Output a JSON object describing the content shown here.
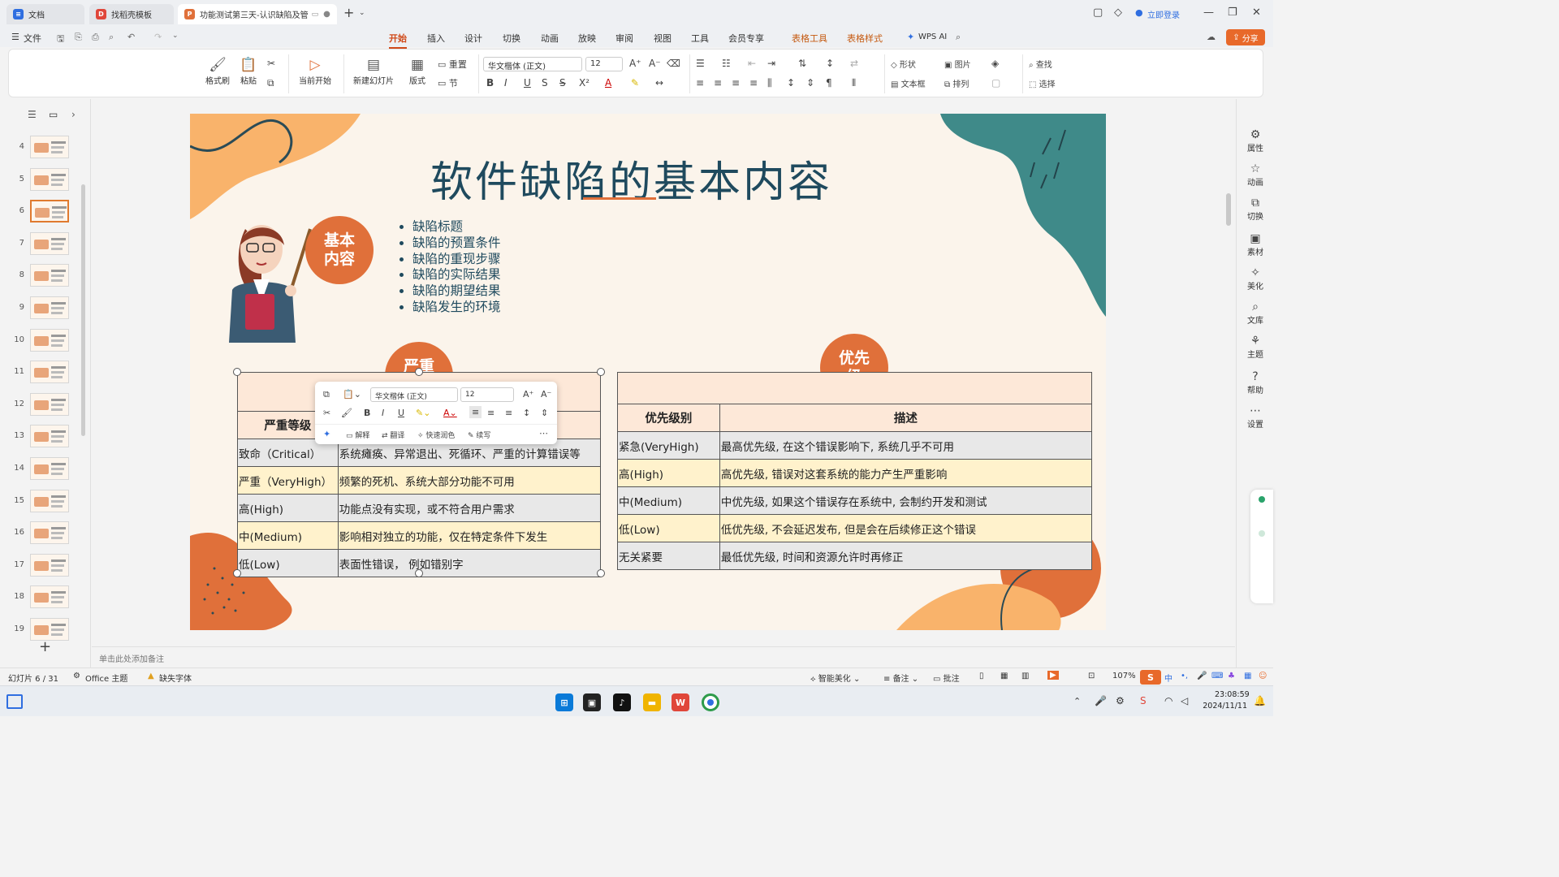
{
  "titlebar": {
    "tabs": [
      {
        "label": "文档",
        "icon": "document-app-icon"
      },
      {
        "label": "找稻壳模板",
        "icon": "docer-template-icon"
      },
      {
        "label": "功能测试第三天-认识缺陷及管",
        "icon": "presentation-file-icon"
      }
    ],
    "login_label": "立即登录"
  },
  "menu": {
    "file_label": "文件",
    "items": [
      "开始",
      "插入",
      "设计",
      "切换",
      "动画",
      "放映",
      "审阅",
      "视图",
      "工具",
      "会员专享",
      "表格工具",
      "表格样式",
      "WPS AI"
    ],
    "share_label": "分享"
  },
  "ribbon": {
    "format_painter": "格式刷",
    "paste": "粘贴",
    "from_current": "当前开始",
    "new_slide": "新建幻灯片",
    "layout": "版式",
    "reset": "重置",
    "section": "节",
    "font_name": "华文楷体 (正文)",
    "font_size": "12",
    "shape": "形状",
    "picture": "图片",
    "textbox": "文本框",
    "arrange": "排列",
    "find": "查找",
    "select": "选择"
  },
  "slides_panel": {
    "numbers": [
      "4",
      "5",
      "6",
      "7",
      "8",
      "9",
      "10",
      "11",
      "12",
      "13",
      "14",
      "15",
      "16",
      "17",
      "18",
      "19"
    ],
    "selected": "6"
  },
  "slide": {
    "title": "软件缺陷的基本内容",
    "badge_basic": "基本\n内容",
    "bullets": [
      "缺陷标题",
      "缺陷的预置条件",
      "缺陷的重现步骤",
      "缺陷的实际结果",
      "缺陷的期望结果",
      "缺陷发生的环境"
    ],
    "badge_severity": "严重\n程度",
    "badge_priority": "优先\n级",
    "severity_table": {
      "headers": [
        "严重等级",
        ""
      ],
      "rows": [
        [
          "致命（Critical）",
          "系统瘫痪、异常退出、死循环、严重的计算错误等"
        ],
        [
          "严重（VeryHigh）",
          "频繁的死机、系统大部分功能不可用"
        ],
        [
          "高(High)",
          "功能点没有实现，或不符合用户需求"
        ],
        [
          "中(Medium)",
          "影响相对独立的功能，仅在特定条件下发生"
        ],
        [
          "低(Low)",
          "表面性错误，  例如错别字"
        ]
      ]
    },
    "priority_table": {
      "headers": [
        "优先级别",
        "描述"
      ],
      "rows": [
        [
          "紧急(VeryHigh)",
          "最高优先级, 在这个错误影响下, 系统几乎不可用"
        ],
        [
          "高(High)",
          "高优先级, 错误对这套系统的能力产生严重影响"
        ],
        [
          "中(Medium)",
          "中优先级, 如果这个错误存在系统中, 会制约开发和测试"
        ],
        [
          "低(Low)",
          "低优先级, 不会延迟发布, 但是会在后续修正这个错误"
        ],
        [
          "无关紧要",
          "最低优先级, 时间和资源允许时再修正"
        ]
      ]
    }
  },
  "floatbar": {
    "font_name": "华文楷体 (正文)",
    "font_size": "12",
    "explain": "解释",
    "translate": "翻译",
    "quick_polish": "快速润色",
    "rewrite": "续写"
  },
  "notes_placeholder": "单击此处添加备注",
  "right_panel": [
    "属性",
    "动画",
    "切换",
    "素材",
    "美化",
    "文库",
    "主题",
    "帮助",
    "设置"
  ],
  "statusbar": {
    "slide_counter": "幻灯片 6 / 31",
    "theme": "Office 主题",
    "missing_font": "缺失字体",
    "smart_beautify": "智能美化",
    "notes": "备注",
    "comments": "批注",
    "zoom": "107%"
  },
  "taskbar": {
    "time": "23:08:59",
    "date": "2024/11/11",
    "ime": "中"
  },
  "colors": {
    "accent_orange": "#e0703a",
    "title_teal": "#1f4a5e",
    "slide_bg": "#fbf4eb",
    "wps_red": "#d04a1a"
  }
}
